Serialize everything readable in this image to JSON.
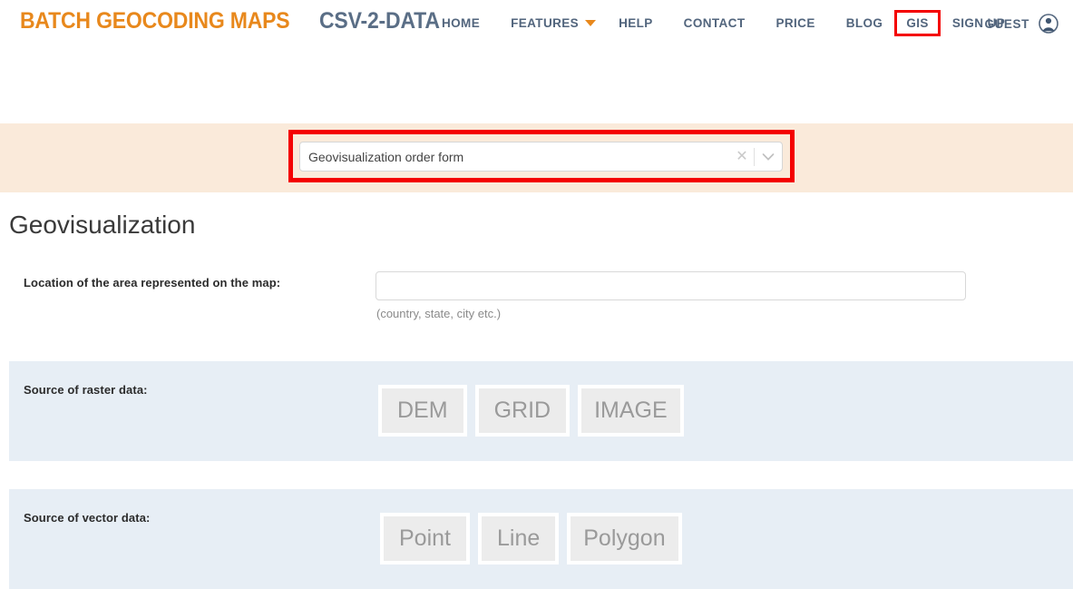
{
  "header": {
    "brand": {
      "part1": "BATCH GEOCODING MAPS",
      "part2": "CSV-2-DATA",
      "color1": "#e8881c",
      "color2": "#5a6e86"
    },
    "nav": [
      {
        "label": "HOME",
        "caret": false,
        "highlighted": false
      },
      {
        "label": "FEATURES",
        "caret": true,
        "highlighted": false
      },
      {
        "label": "HELP",
        "caret": false,
        "highlighted": false
      },
      {
        "label": "CONTACT",
        "caret": false,
        "highlighted": false
      },
      {
        "label": "PRICE",
        "caret": false,
        "highlighted": false
      },
      {
        "label": "BLOG",
        "caret": false,
        "highlighted": false
      },
      {
        "label": "GIS",
        "caret": false,
        "highlighted": true
      },
      {
        "label": "SIGN UP",
        "caret": false,
        "highlighted": false
      }
    ],
    "user": {
      "label": "GUEST",
      "icon": "user-account-icon"
    },
    "highlight_color": "#f40000"
  },
  "form_selector": {
    "selected_value": "Geovisualization order form",
    "clear_icon": "close-icon",
    "arrow_icon": "chevron-down-icon",
    "band_color": "#faeada",
    "highlight_color": "#f40000"
  },
  "page": {
    "title": "Geovisualization"
  },
  "fields": {
    "location": {
      "label": "Location of the area represented on the map:",
      "value": "",
      "placeholder": "",
      "hint": "(country, state, city etc.)"
    },
    "raster": {
      "label": "Source of raster data:",
      "options": [
        "DEM",
        "GRID",
        "IMAGE"
      ]
    },
    "vector": {
      "label": "Source of vector data:",
      "options": [
        "Point",
        "Line",
        "Polygon"
      ]
    }
  },
  "colors": {
    "panel_tint": "#e7eef5",
    "button_fill": "#ececec",
    "button_text": "#9a9a9a",
    "nav_text": "#52657d"
  }
}
